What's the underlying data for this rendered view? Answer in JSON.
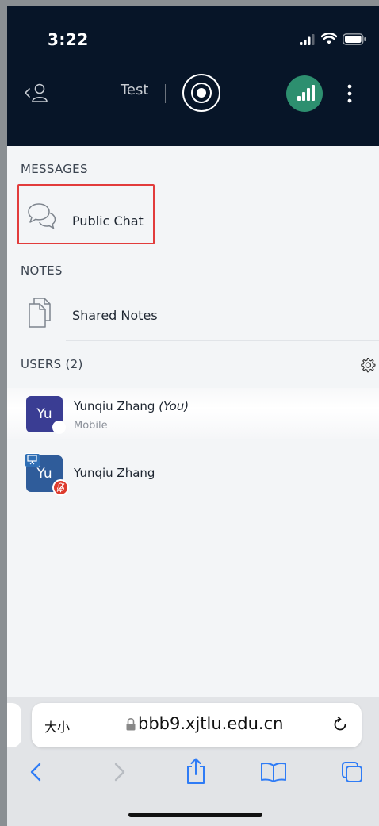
{
  "status_bar": {
    "time": "3:22"
  },
  "header": {
    "title": "Test"
  },
  "sections": {
    "messages": {
      "heading": "MESSAGES",
      "public_chat": "Public Chat"
    },
    "notes": {
      "heading": "NOTES",
      "shared_notes": "Shared Notes"
    },
    "users": {
      "heading": "USERS (2)",
      "list": [
        {
          "initials": "Yu",
          "name": "Yunqiu Zhang",
          "you_tag": "(You)",
          "sub": "Mobile",
          "avatar_color": "#3a3d93"
        },
        {
          "initials": "Yu",
          "name": "Yunqiu Zhang",
          "avatar_color": "#2f5c9a"
        }
      ]
    }
  },
  "browser": {
    "text_size_label": "大小",
    "url": "bbb9.xjtlu.edu.cn"
  },
  "colors": {
    "header_bg": "#071528",
    "connection_ok": "#2d8f6f",
    "highlight_border": "#e23c3c",
    "mic_off": "#dd3b2e",
    "safari_accent": "#2f7cf6"
  },
  "icons": {
    "status": [
      "signal-icon",
      "wifi-icon",
      "battery-icon"
    ],
    "header": [
      "user-back-icon",
      "record-icon",
      "connection-status-icon",
      "more-vertical-icon"
    ],
    "rows": [
      "chat-bubbles-icon",
      "documents-icon",
      "gear-icon",
      "presenter-icon",
      "mic-muted-icon"
    ],
    "safari": [
      "lock-icon",
      "reload-icon",
      "back-icon",
      "forward-icon",
      "share-icon",
      "bookmarks-icon",
      "tabs-icon"
    ]
  }
}
